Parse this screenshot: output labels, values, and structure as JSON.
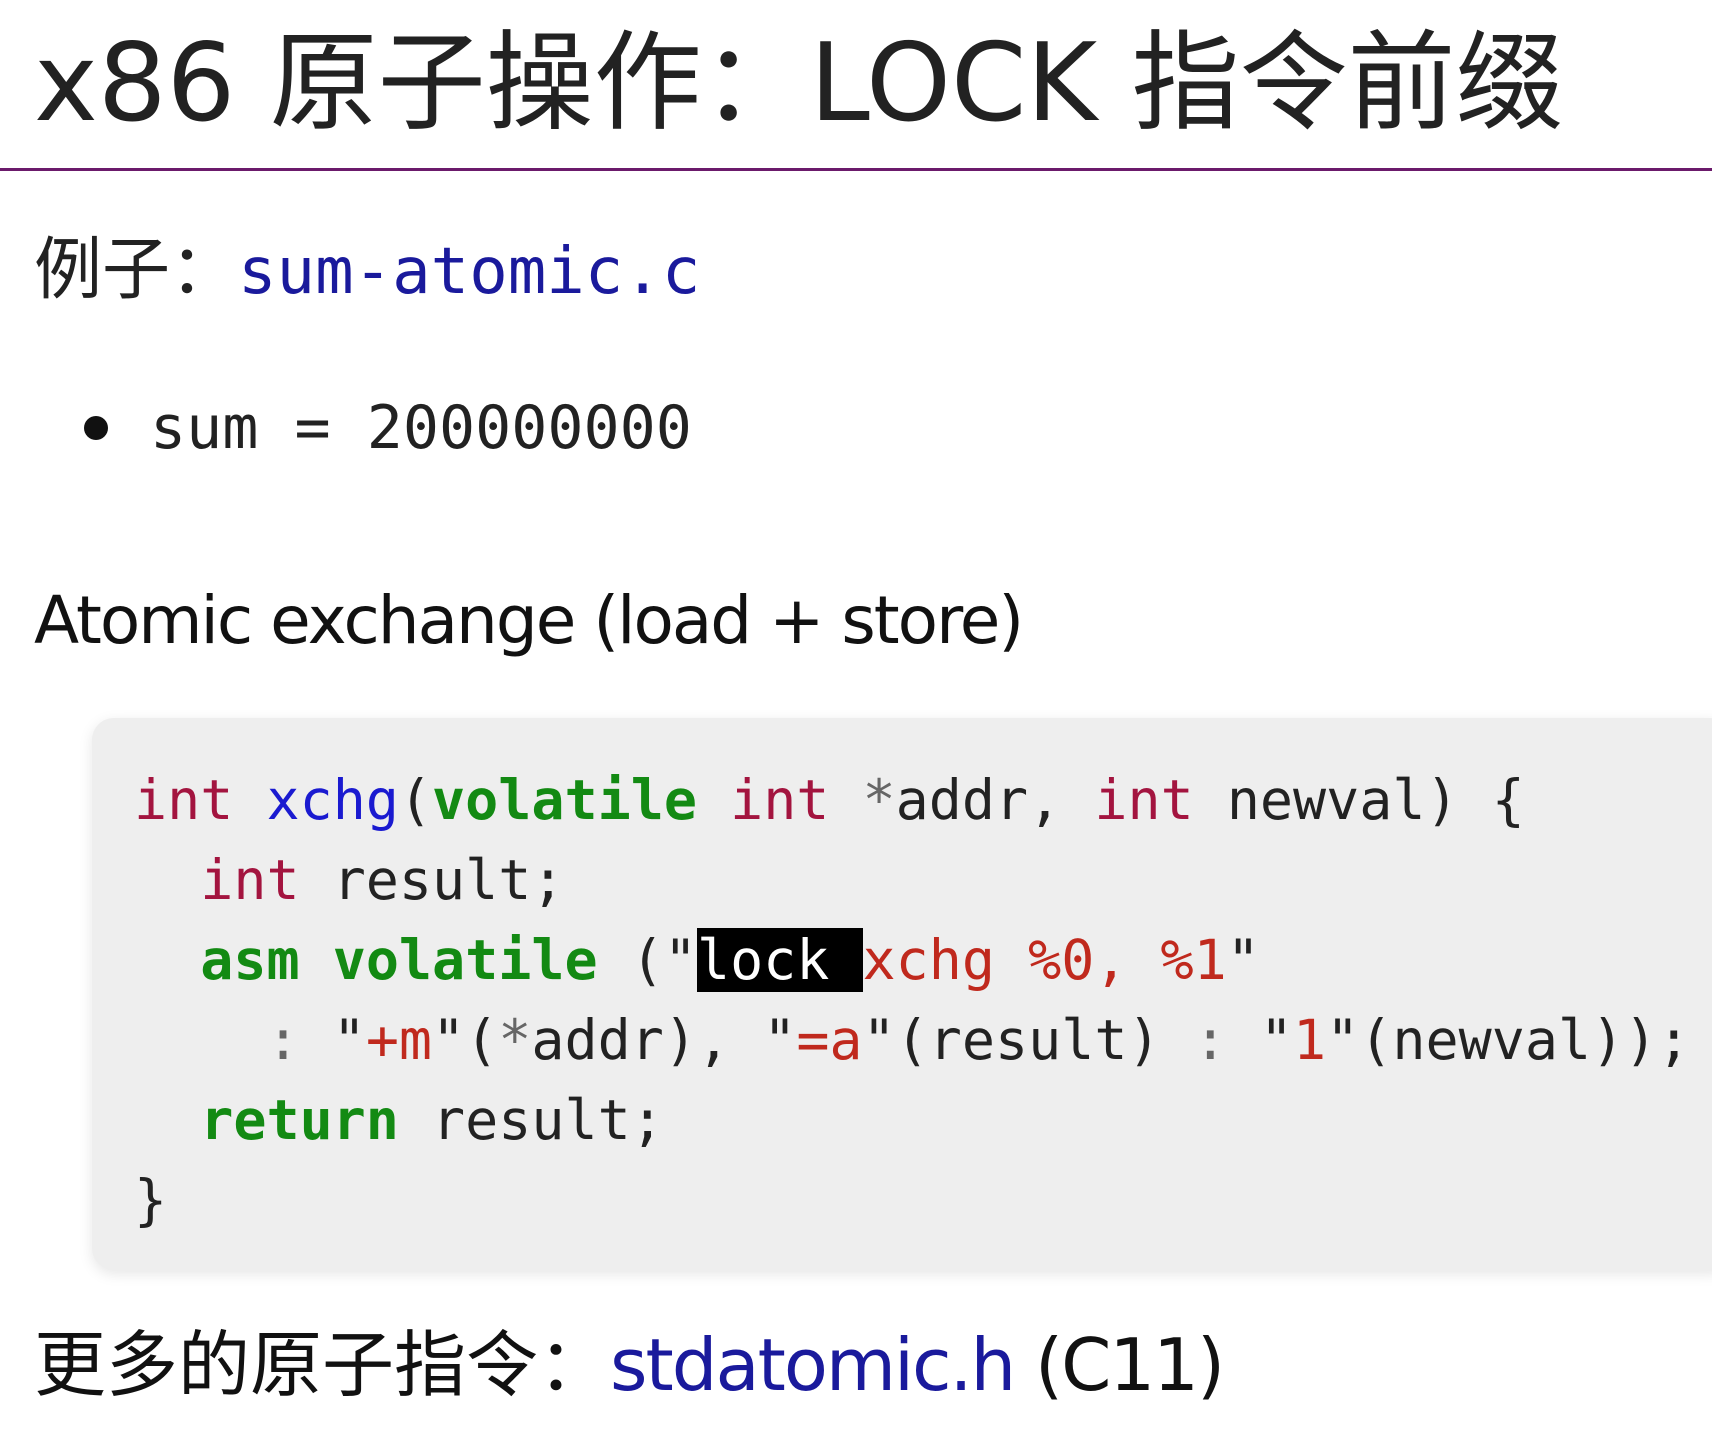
{
  "title": "x86 原子操作：LOCK 指令前缀",
  "example": {
    "label": "例子：",
    "link_text": "sum-atomic.c"
  },
  "bullets": [
    "sum = 200000000"
  ],
  "section_heading": "Atomic exchange (load + store)",
  "code": {
    "lines": [
      [
        {
          "text": "int",
          "kind": "type"
        },
        {
          "text": " ",
          "kind": "plain"
        },
        {
          "text": "xchg",
          "kind": "fn"
        },
        {
          "text": "(",
          "kind": "plain"
        },
        {
          "text": "volatile",
          "kind": "kw"
        },
        {
          "text": " ",
          "kind": "plain"
        },
        {
          "text": "int",
          "kind": "type"
        },
        {
          "text": " ",
          "kind": "plain"
        },
        {
          "text": "*",
          "kind": "op"
        },
        {
          "text": "addr, ",
          "kind": "plain"
        },
        {
          "text": "int",
          "kind": "type"
        },
        {
          "text": " newval) {",
          "kind": "plain"
        }
      ],
      [
        {
          "text": "  ",
          "kind": "plain"
        },
        {
          "text": "int",
          "kind": "type"
        },
        {
          "text": " result;",
          "kind": "plain"
        }
      ],
      [
        {
          "text": "  ",
          "kind": "plain"
        },
        {
          "text": "asm",
          "kind": "kw"
        },
        {
          "text": " ",
          "kind": "plain"
        },
        {
          "text": "volatile",
          "kind": "kw"
        },
        {
          "text": " (\"",
          "kind": "plain"
        },
        {
          "text": "lock ",
          "kind": "hl"
        },
        {
          "text": "xchg %0, %1",
          "kind": "str"
        },
        {
          "text": "\"",
          "kind": "plain"
        }
      ],
      [
        {
          "text": "    ",
          "kind": "plain"
        },
        {
          "text": ":",
          "kind": "op"
        },
        {
          "text": " \"",
          "kind": "plain"
        },
        {
          "text": "+m",
          "kind": "str"
        },
        {
          "text": "\"(",
          "kind": "plain"
        },
        {
          "text": "*",
          "kind": "op"
        },
        {
          "text": "addr), \"",
          "kind": "plain"
        },
        {
          "text": "=a",
          "kind": "str"
        },
        {
          "text": "\"(result) ",
          "kind": "plain"
        },
        {
          "text": ":",
          "kind": "op"
        },
        {
          "text": " \"",
          "kind": "plain"
        },
        {
          "text": "1",
          "kind": "str"
        },
        {
          "text": "\"(newval));",
          "kind": "plain"
        }
      ],
      [
        {
          "text": "  ",
          "kind": "plain"
        },
        {
          "text": "return",
          "kind": "kw"
        },
        {
          "text": " result;",
          "kind": "plain"
        }
      ],
      [
        {
          "text": "}",
          "kind": "plain"
        }
      ]
    ]
  },
  "more": {
    "label": "更多的原子指令：",
    "link_text": "stdatomic.h",
    "suffix": " (C11)"
  },
  "colors": {
    "title_rule": "#6b1a6b",
    "link": "#1a1a9c",
    "type": "#a3143f",
    "function": "#1a1ad0",
    "keyword": "#138a13",
    "string": "#c0291d",
    "code_background": "#eeeeee",
    "highlight_background": "#000000"
  }
}
